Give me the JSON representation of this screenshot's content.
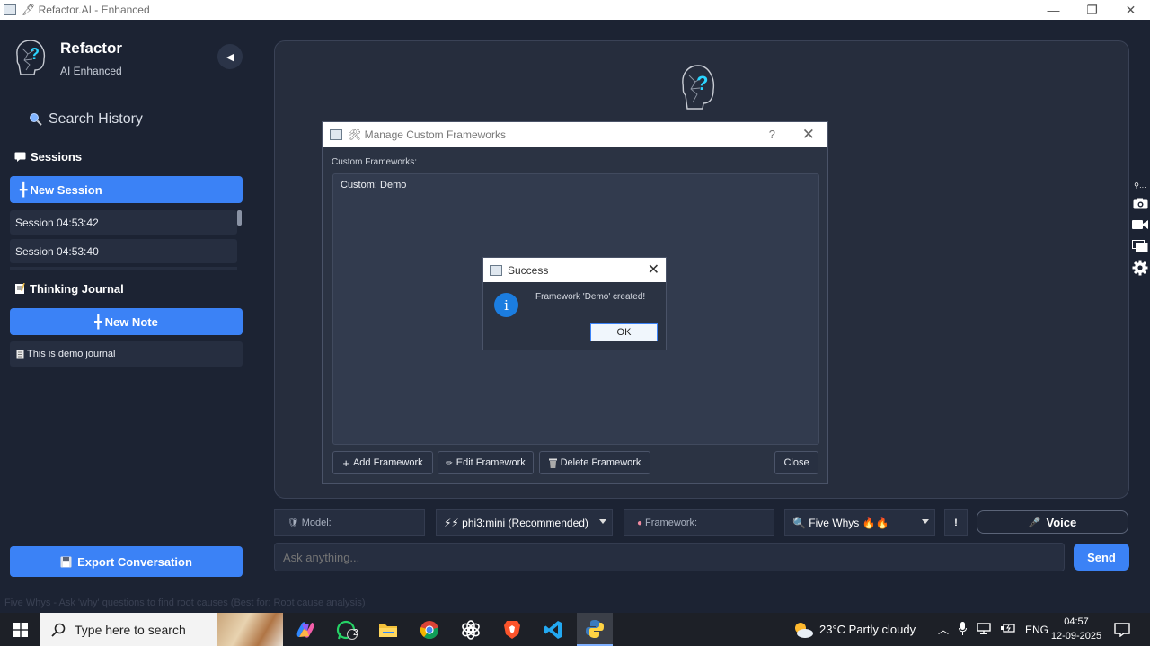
{
  "window": {
    "title": "🖋 Refactor.AI - Enhanced",
    "controls": [
      "—",
      "❐",
      "✕"
    ]
  },
  "sidebar": {
    "brand_title": "Refactor",
    "brand_subtitle": "AI Enhanced",
    "collapse_glyph": "◀",
    "search_history": "Search History",
    "sessions_header": "Sessions",
    "new_session": "New Session",
    "sessions": [
      "Session 04:53:42",
      "Session 04:53:40"
    ],
    "journal_header": "Thinking Journal",
    "new_note": "New Note",
    "journal_items": [
      "This is demo journal"
    ],
    "export": "Export Conversation"
  },
  "dialog": {
    "title": "🛠 Manage Custom Frameworks",
    "help": "?",
    "list_label": "Custom Frameworks:",
    "items": [
      "Custom: Demo"
    ],
    "add_button": "Add Framework",
    "edit_button": "Edit Framework",
    "delete_button": "Delete Framework",
    "close_button": "Close"
  },
  "message_box": {
    "title": "Success",
    "message": "Framework 'Demo' created!",
    "ok_button": "OK"
  },
  "controls": {
    "model_label": "Model:",
    "model_value": "⚡⚡ phi3:mini (Recommended)",
    "framework_label": "Framework:",
    "framework_value": "🔍 Five Whys 🔥🔥",
    "info_button": "!",
    "voice_button": "Voice"
  },
  "input": {
    "placeholder": "Ask anything...",
    "send": "Send"
  },
  "status_line": "Five Whys - Ask 'why' questions to find root causes (Best for: Root cause analysis)",
  "taskbar": {
    "search_placeholder": "Type here to search",
    "whatsapp_badge": "2",
    "weather": "23°C  Partly cloudy",
    "language": "ENG",
    "time": "04:57",
    "date": "12-09-2025"
  },
  "colors": {
    "accent": "#3b82f6",
    "background": "#1c2333",
    "panel": "#262d3d"
  },
  "icons": [
    "brain-head-icon",
    "search-icon",
    "chat-icon",
    "plus-icon",
    "notebook-icon",
    "document-icon",
    "floppy-icon",
    "camera-icon",
    "video-icon",
    "layers-icon",
    "gear-icon",
    "info-icon",
    "microphone-icon",
    "windows-icon"
  ]
}
